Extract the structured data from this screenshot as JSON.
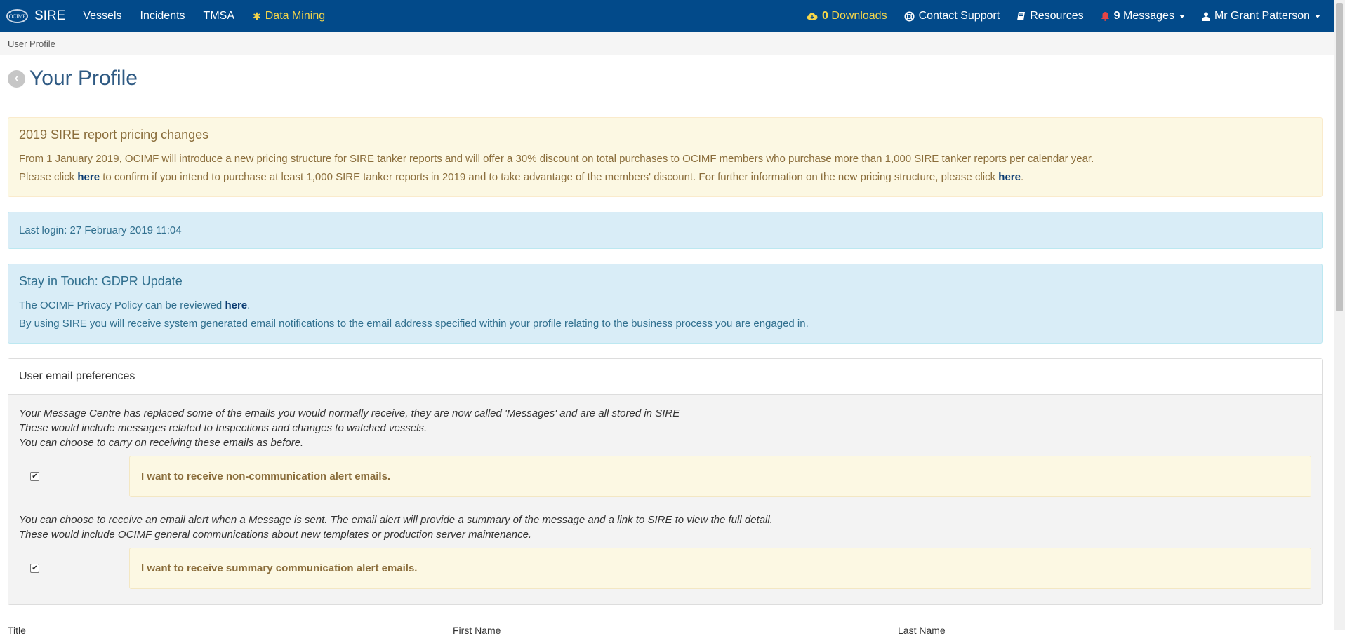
{
  "nav": {
    "brand_logo": "OCIMF",
    "brand": "SIRE",
    "left_items": [
      "Vessels",
      "Incidents",
      "TMSA"
    ],
    "data_mining": "Data Mining",
    "downloads_count": "0",
    "downloads_label": "Downloads",
    "contact_support": "Contact Support",
    "resources": "Resources",
    "messages_count": "9",
    "messages_label": "Messages",
    "user_name": "Mr Grant Patterson",
    "colors": {
      "bar": "#024a8a",
      "highlight": "#f5d64a",
      "bell": "#e64545"
    }
  },
  "breadcrumb": "User Profile",
  "page_title": "Your Profile",
  "pricing_alert": {
    "heading": "2019 SIRE report pricing changes",
    "line1": "From 1 January 2019, OCIMF will introduce a new pricing structure for SIRE tanker reports and will offer a 30% discount on total purchases to OCIMF members who purchase more than 1,000 SIRE tanker reports per calendar year.",
    "line2_prefix": "Please click ",
    "line2_link": "here",
    "line2_middle": " to confirm if you intend to purchase at least 1,000 SIRE tanker reports in 2019 and to take advantage of the members' discount. For further information on the new pricing structure, please click ",
    "line2_link2": "here",
    "line2_suffix": "."
  },
  "last_login": "Last login: 27 February 2019 11:04",
  "gdpr_alert": {
    "heading": "Stay in Touch: GDPR Update",
    "line1_prefix": "The OCIMF Privacy Policy can be reviewed ",
    "line1_link": "here",
    "line1_suffix": ".",
    "line2": "By using SIRE you will receive system generated email notifications to the email address specified within your profile relating to the business process you are engaged in."
  },
  "email_prefs": {
    "heading": "User email preferences",
    "intro1": "Your Message Centre has replaced some of the emails you would normally receive, they are now called 'Messages' and are all stored in SIRE",
    "intro2": "These would include messages related to Inspections and changes to watched vessels.",
    "intro3": "You can choose to carry on receiving these emails as before.",
    "option1_checked": true,
    "option1_label": "I want to receive non-communication alert emails.",
    "summary1": "You can choose to receive an email alert when a Message is sent. The email alert will provide a summary of the message and a link to SIRE to view the full detail.",
    "summary2": "These would include OCIMF general communications about new templates or production server maintenance.",
    "option2_checked": true,
    "option2_label": "I want to receive summary communication alert emails."
  },
  "form_labels": [
    "Title",
    "First Name",
    "Last Name"
  ]
}
